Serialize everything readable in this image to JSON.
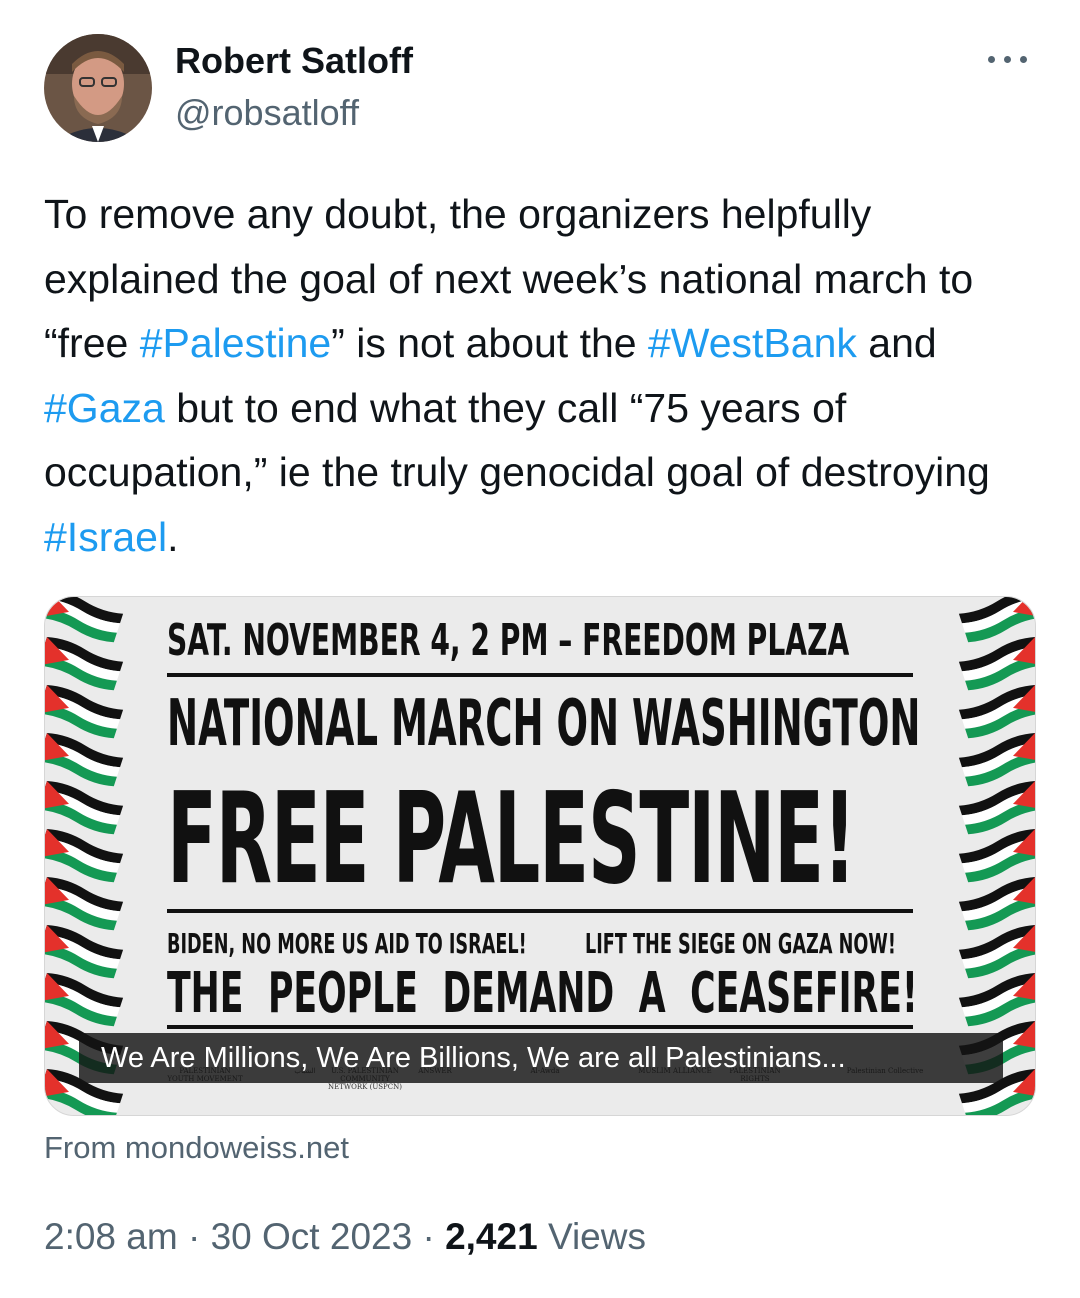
{
  "author": {
    "name": "Robert Satloff",
    "handle": "@robsatloff"
  },
  "more_icon": "more-horizontal-icon",
  "tweet": {
    "segments": [
      {
        "text": "To remove any doubt, the organizers helpfully explained the goal of next week’s national march to “free ",
        "tag": false
      },
      {
        "text": "#Palestine",
        "tag": true
      },
      {
        "text": "” is not about the ",
        "tag": false
      },
      {
        "text": "#WestBank",
        "tag": true
      },
      {
        "text": " and ",
        "tag": false
      },
      {
        "text": "#Gaza",
        "tag": true
      },
      {
        "text": " but to end what they call “75 years of occupation,” ie the truly genocidal goal of destroying ",
        "tag": false
      },
      {
        "text": "#Israel",
        "tag": true
      },
      {
        "text": ".",
        "tag": false
      }
    ]
  },
  "card": {
    "poster": {
      "line1": "SAT. NOVEMBER 4, 2 PM – FREEDOM PLAZA",
      "line2": "NATIONAL MARCH ON WASHINGTON",
      "line3": "FREE PALESTINE!",
      "line4a": "BIDEN, NO MORE US AID TO ISRAEL!",
      "line4b": "LIFT THE SIEGE ON GAZA NOW!",
      "line5": "THE PEOPLE DEMAND A CEASEFIRE!"
    },
    "logos": [
      "PALESTINIAN YOUTH MOVEMENT",
      "الشباب",
      "U.S. PALESTINIAN COMMUNITY NETWORK (USPCN)",
      "ANSWER",
      "Al-Awda",
      "MUSLIM ALLIANCE",
      "PALESTINIAN RIGHTS",
      "Palestinian Collective"
    ],
    "caption": "We Are Millions, We Are Billions, We are all Palestinians...",
    "source": "From mondoweiss.net"
  },
  "meta": {
    "time": "2:08 am",
    "separator": " · ",
    "date": "30 Oct 2023",
    "views_count": "2,421",
    "views_label": " Views"
  },
  "colors": {
    "link": "#1d9bf0",
    "secondary_text": "#536471",
    "primary_text": "#0f1419",
    "flag_red": "#e4312b",
    "flag_green": "#149954",
    "flag_black": "#111111"
  }
}
